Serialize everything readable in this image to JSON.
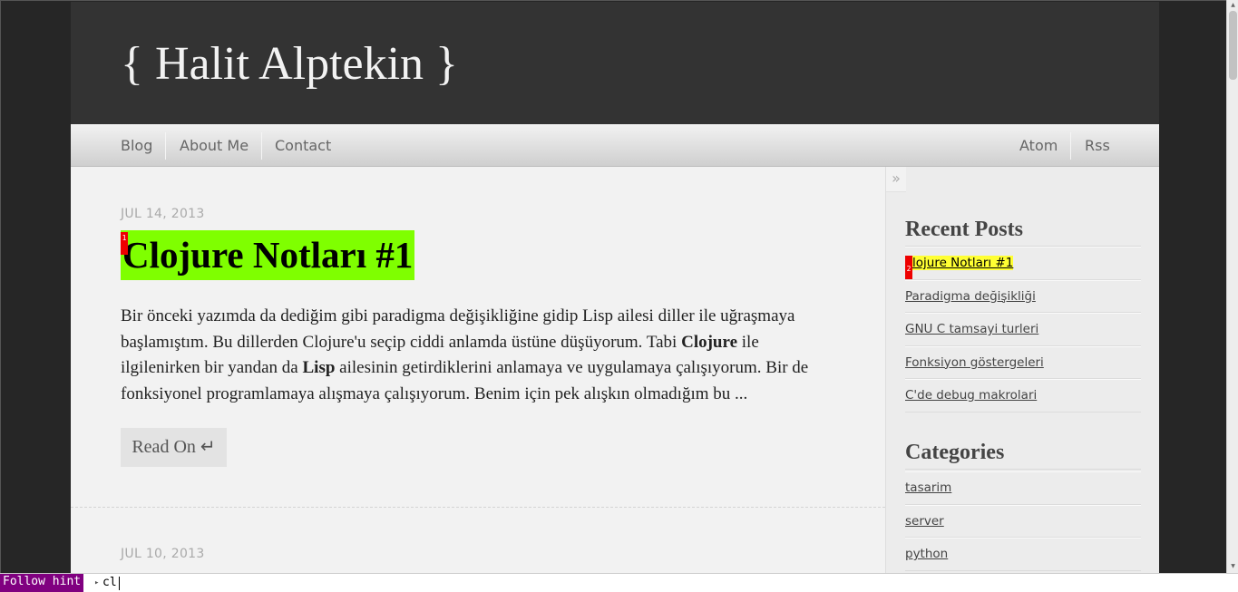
{
  "site": {
    "title": "{ Halit Alptekin }"
  },
  "nav": {
    "left": [
      "Blog",
      "About Me",
      "Contact"
    ],
    "right": [
      "Atom",
      "Rss"
    ]
  },
  "posts": [
    {
      "date": "JUL 14, 2013",
      "title": "Clojure Notları #1",
      "hint": "1",
      "excerpt": {
        "p1": "Bir önceki yazımda da dediğim gibi paradigma değişikliğine gidip Lisp ailesi diller ile uğraşmaya başlamıştım. Bu dillerden Clojure'u seçip ciddi anlamda üstüne düşüyorum. Tabi ",
        "b1": "Clojure",
        "p2": " ile ilgilenirken bir yandan da ",
        "b2": "Lisp",
        "p3": " ailesinin getirdiklerini anlamaya ve uygulamaya çalışıyorum. Bir de fonksiyonel programlamaya alışmaya çalışıyorum. Benim için pek alışkın olmadığım bu ..."
      },
      "read_on": "Read On ↵"
    },
    {
      "date": "JUL 10, 2013"
    }
  ],
  "sidebar": {
    "collapse_glyph": "»",
    "recent_heading": "Recent Posts",
    "recent_posts": [
      {
        "label": "lojure Notları #1",
        "hint": "2"
      },
      {
        "label": "Paradigma değişikliği"
      },
      {
        "label": "GNU C tamsayi turleri"
      },
      {
        "label": "Fonksiyon göstergeleri"
      },
      {
        "label": "C'de debug makrolari"
      }
    ],
    "categories_heading": "Categories",
    "categories": [
      "tasarim",
      "server",
      "python"
    ]
  },
  "statusbar": {
    "mode": "Follow hint",
    "prompt": "▸",
    "input_value": "cl"
  },
  "colors": {
    "hint_highlight": "#7fff00",
    "link_highlight": "#ffff33",
    "hint_badge": "#ee0000",
    "mode_label": "#800080"
  }
}
